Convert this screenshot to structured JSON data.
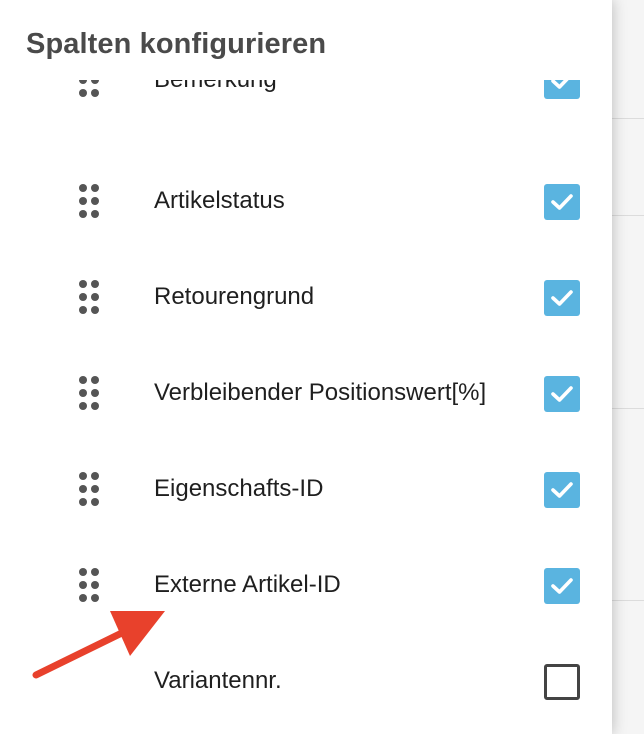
{
  "dialog": {
    "title": "Spalten konfigurieren"
  },
  "columns": [
    {
      "label": "Bemerkung",
      "checked": true,
      "draggable": true
    },
    {
      "label": "Artikelstatus",
      "checked": true,
      "draggable": true
    },
    {
      "label": "Retourengrund",
      "checked": true,
      "draggable": true
    },
    {
      "label": "Verbleibender Positionswert[%]",
      "checked": true,
      "draggable": true
    },
    {
      "label": "Eigenschafts-ID",
      "checked": true,
      "draggable": true
    },
    {
      "label": "Externe Artikel-ID",
      "checked": true,
      "draggable": true
    },
    {
      "label": "Variantennr.",
      "checked": false,
      "draggable": false
    }
  ],
  "colors": {
    "checkbox_checked": "#5ab4e0",
    "annotation_arrow": "#e8412c",
    "title_text": "#4a4a4a"
  },
  "icons": {
    "drag_handle": "drag-handle-icon",
    "checkmark": "check-icon",
    "annotation": "red-arrow"
  }
}
